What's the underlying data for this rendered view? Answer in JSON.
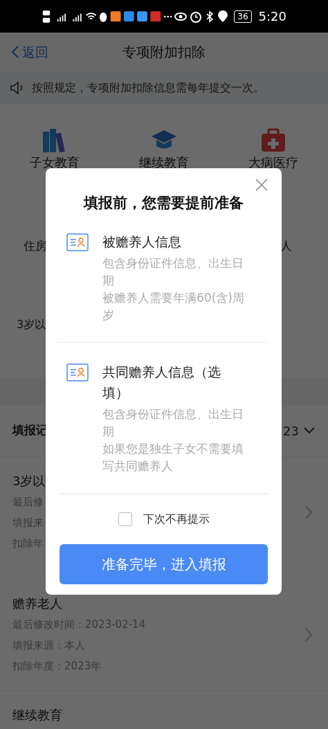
{
  "status_bar": {
    "battery": "36",
    "time": "5:20"
  },
  "nav": {
    "back": "返回",
    "title": "专项附加扣除"
  },
  "notice": "按照规定，专项附加扣除信息需每年提交一次。",
  "categories": [
    {
      "label": "子女教育",
      "kind": "books"
    },
    {
      "label": "继续教育",
      "kind": "cap"
    },
    {
      "label": "大病医疗",
      "kind": "medkit"
    }
  ],
  "category_row_2": {
    "left": "住房",
    "right": "人"
  },
  "category_row_3": {
    "left": "3岁以"
  },
  "records_header": {
    "title": "填报记",
    "year": "23"
  },
  "records": [
    {
      "title": "3岁以",
      "lines": [
        "最后修",
        "填报来",
        "扣除年"
      ]
    },
    {
      "title": "赡养老人",
      "lines": [
        "最后修改时间：2023-02-14",
        "填报来源：本人",
        "扣除年度：2023年"
      ]
    },
    {
      "title": "继续教育"
    }
  ],
  "dialog": {
    "title": "填报前，您需要提前准备",
    "items": [
      {
        "title": "被赡养人信息",
        "notes": [
          "包含身份证件信息、出生日期",
          "被赡养人需要年满60(含)周岁"
        ]
      },
      {
        "title": "共同赡养人信息（选填）",
        "notes": [
          "包含身份证件信息、出生日期",
          "如果您是独生子女不需要填写共同赡养人"
        ]
      }
    ],
    "dont_show_again": {
      "label": "下次不再提示",
      "checked": false
    },
    "confirm": "准备完毕，进入填报"
  }
}
